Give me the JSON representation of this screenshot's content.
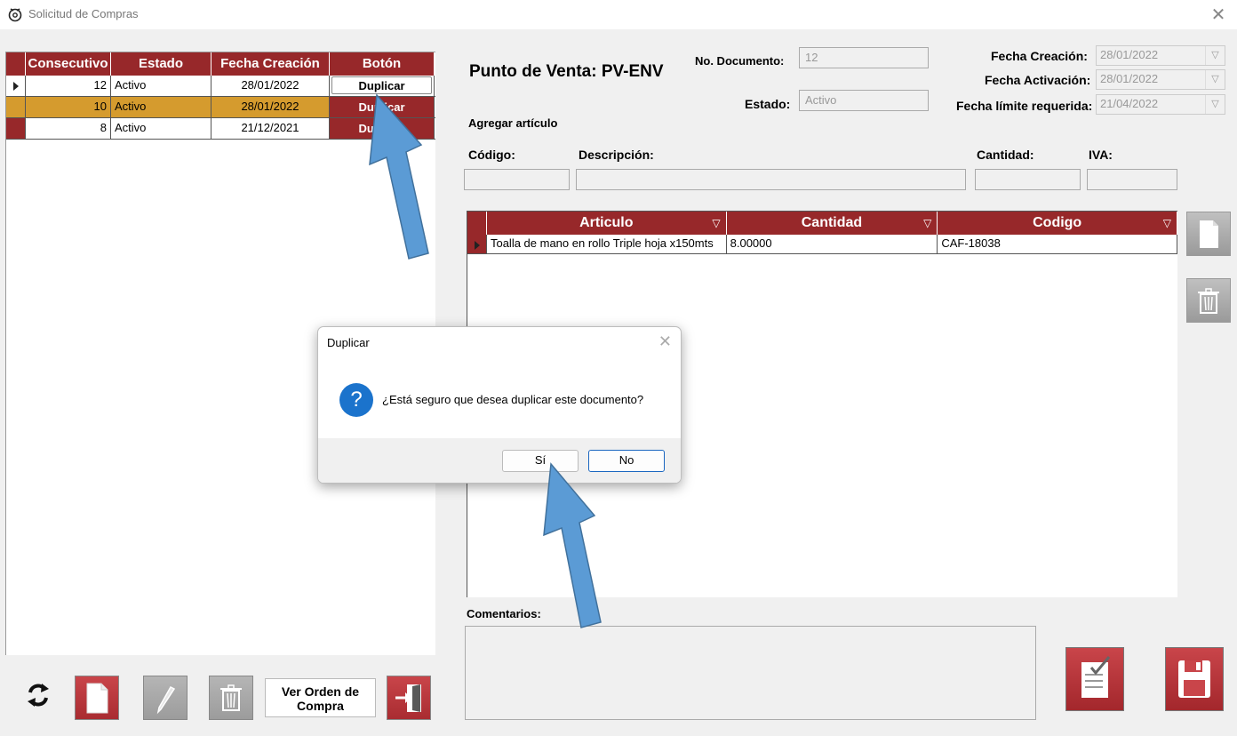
{
  "window": {
    "title": "Solicitud de Compras",
    "close_glyph": "✕"
  },
  "left_grid": {
    "columns": [
      "Consecutivo",
      "Estado",
      "Fecha Creación",
      "Botón"
    ],
    "rows": [
      {
        "consecutivo": "12",
        "estado": "Activo",
        "fecha": "28/01/2022",
        "boton": "Duplicar"
      },
      {
        "consecutivo": "10",
        "estado": "Activo",
        "fecha": "28/01/2022",
        "boton": "Duplicar"
      },
      {
        "consecutivo": "8",
        "estado": "Activo",
        "fecha": "21/12/2021",
        "boton": "Duplicar"
      }
    ]
  },
  "toolbar": {
    "ver_orden": "Ver Orden de Compra"
  },
  "header": {
    "punto_venta": "Punto de Venta: PV-ENV",
    "no_documento_label": "No. Documento:",
    "no_documento_value": "12",
    "estado_label": "Estado:",
    "estado_value": "Activo",
    "fecha_creacion_label": "Fecha Creación:",
    "fecha_creacion_value": "28/01/2022",
    "fecha_activacion_label": "Fecha Activación:",
    "fecha_activacion_value": "28/01/2022",
    "fecha_limite_label": "Fecha límite requerida:",
    "fecha_limite_value": "21/04/2022"
  },
  "add_item": {
    "title": "Agregar artículo",
    "codigo_label": "Código:",
    "descripcion_label": "Descripción:",
    "cantidad_label": "Cantidad:",
    "iva_label": "IVA:"
  },
  "articles_grid": {
    "columns": [
      "Articulo",
      "Cantidad",
      "Codigo"
    ],
    "rows": [
      {
        "articulo": "Toalla de mano en rollo Triple hoja x150mts",
        "cantidad": "8.00000",
        "codigo": "CAF-18038"
      }
    ]
  },
  "comentarios_label": "Comentarios:",
  "dialog": {
    "title": "Duplicar",
    "icon_glyph": "?",
    "message": "¿Está seguro que desea duplicar este documento?",
    "yes_label": "Sí",
    "no_label": "No"
  },
  "colors": {
    "accent": "#97282a",
    "selected_row": "#d59b2e",
    "arrow": "#5b9bd5",
    "question_icon": "#1b73cc"
  }
}
